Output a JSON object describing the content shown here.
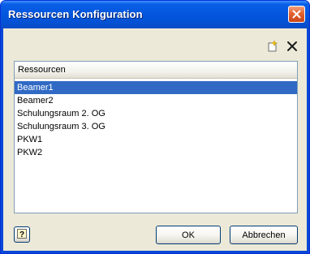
{
  "window": {
    "title": "Ressourcen Konfiguration"
  },
  "toolbar": {
    "icons": [
      "new-icon",
      "delete-icon"
    ]
  },
  "list": {
    "header": "Ressourcen",
    "items": [
      {
        "label": "Beamer1",
        "selected": true
      },
      {
        "label": "Beamer2",
        "selected": false
      },
      {
        "label": "Schulungsraum 2. OG",
        "selected": false
      },
      {
        "label": "Schulungsraum 3. OG",
        "selected": false
      },
      {
        "label": "PKW1",
        "selected": false
      },
      {
        "label": "PKW2",
        "selected": false
      }
    ]
  },
  "buttons": {
    "ok_label": "OK",
    "cancel_label": "Abbrechen",
    "help_icon": "help-icon"
  },
  "colors": {
    "titlebar": "#0558e0",
    "selection": "#316ac5",
    "dialog_bg": "#ece9d8",
    "close_button": "#e4622f"
  }
}
